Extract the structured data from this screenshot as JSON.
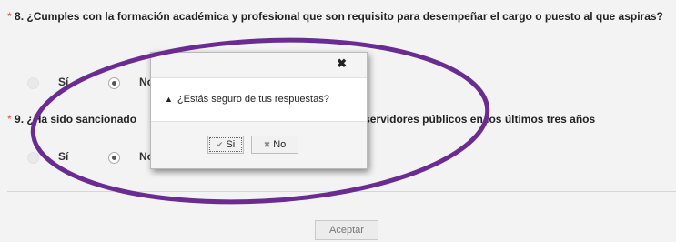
{
  "questions": [
    {
      "required_mark": "*",
      "text": "8. ¿Cumples con la formación académica y profesional que son requisito para desempeñar el cargo o puesto al que aspiras?",
      "options": [
        "Sí",
        "No"
      ],
      "selected": "No"
    },
    {
      "required_mark": "*",
      "text": "9. ¿Ha sido sancionado                                                          vidoras o servidores públicos en los últimos tres años",
      "options": [
        "Sí",
        "No"
      ],
      "selected": "No"
    }
  ],
  "accept_label": "Aceptar",
  "dialog": {
    "close_glyph": "✖",
    "warning_glyph": "▲",
    "message": "¿Estás seguro de tus respuestas?",
    "yes_label": "Si",
    "yes_glyph": "✔",
    "no_label": "No",
    "no_glyph": "✖"
  },
  "annotation_color": "#6a2c91"
}
